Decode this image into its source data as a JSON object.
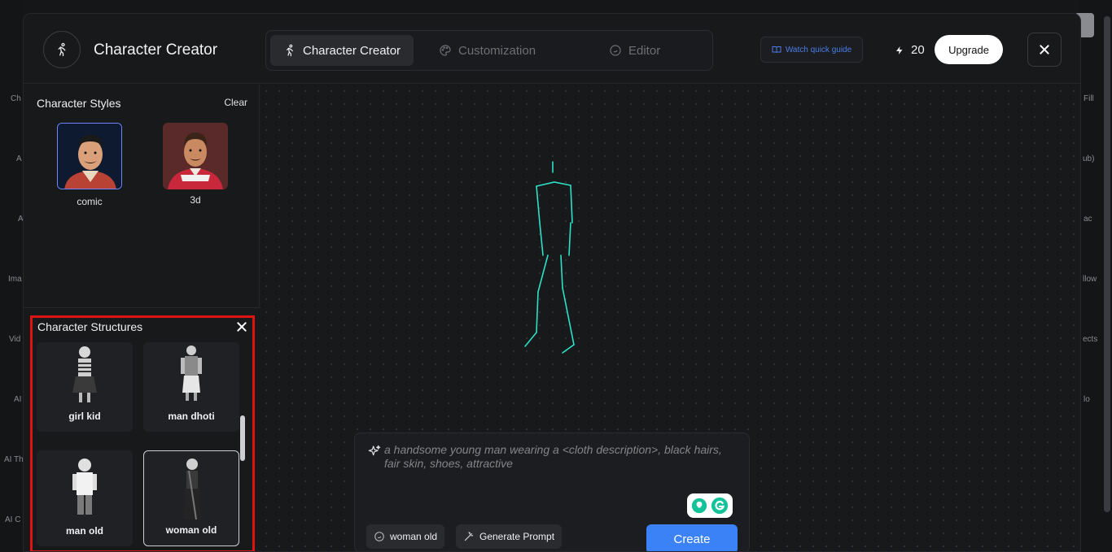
{
  "background": {
    "left_labels": [
      "Ch",
      "A",
      "A",
      "Ima",
      "Vid",
      "AI",
      "AI Th",
      "AI C"
    ],
    "right_labels": [
      "Fill",
      "ub)",
      "ac",
      "llow",
      "ects",
      "lo"
    ]
  },
  "header": {
    "app_title": "Character Creator",
    "tabs": [
      {
        "label": "Character Creator",
        "active": true
      },
      {
        "label": "Customization",
        "active": false
      },
      {
        "label": "Editor",
        "active": false
      }
    ],
    "guide_label": "Watch quick guide",
    "credits": "20",
    "upgrade_label": "Upgrade"
  },
  "styles": {
    "title": "Character Styles",
    "clear_label": "Clear",
    "items": [
      {
        "label": "comic",
        "selected": true
      },
      {
        "label": "3d",
        "selected": false
      }
    ]
  },
  "structures": {
    "title": "Character Structures",
    "items": [
      {
        "label": "girl kid",
        "selected": false
      },
      {
        "label": "man dhoti",
        "selected": false
      },
      {
        "label": "man old",
        "selected": false
      },
      {
        "label": "woman old",
        "selected": true
      }
    ]
  },
  "prompt": {
    "placeholder": "a handsome young man wearing a <cloth description>, black hairs, fair skin, shoes, attractive",
    "chip_structure": "woman old",
    "chip_generate": "Generate Prompt",
    "create_label": "Create"
  },
  "colors": {
    "accent_blue": "#3b82f6",
    "highlight_red": "#e01212",
    "skeleton_cyan": "#2de0c8"
  }
}
